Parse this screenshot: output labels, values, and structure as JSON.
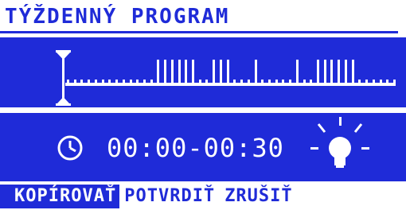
{
  "screen": {
    "title": "TÝŽDENNÝ PROGRAM"
  },
  "timeline": {
    "marker_icon": "hourglass-cursor-icon",
    "active_segments": 18
  },
  "time_slot": {
    "clock_icon": "clock-icon",
    "range": "00:00-00:30",
    "state_icon": "light-bulb-on-icon"
  },
  "menu": {
    "items": [
      {
        "label": "KOPÍROVAŤ",
        "selected": true
      },
      {
        "label": "POTVRDIŤ",
        "selected": false
      },
      {
        "label": "ZRUŠIŤ",
        "selected": false
      }
    ]
  },
  "colors": {
    "accent": "#1f2bd8",
    "text_on_accent": "#ffffff",
    "background": "#ffffff"
  }
}
